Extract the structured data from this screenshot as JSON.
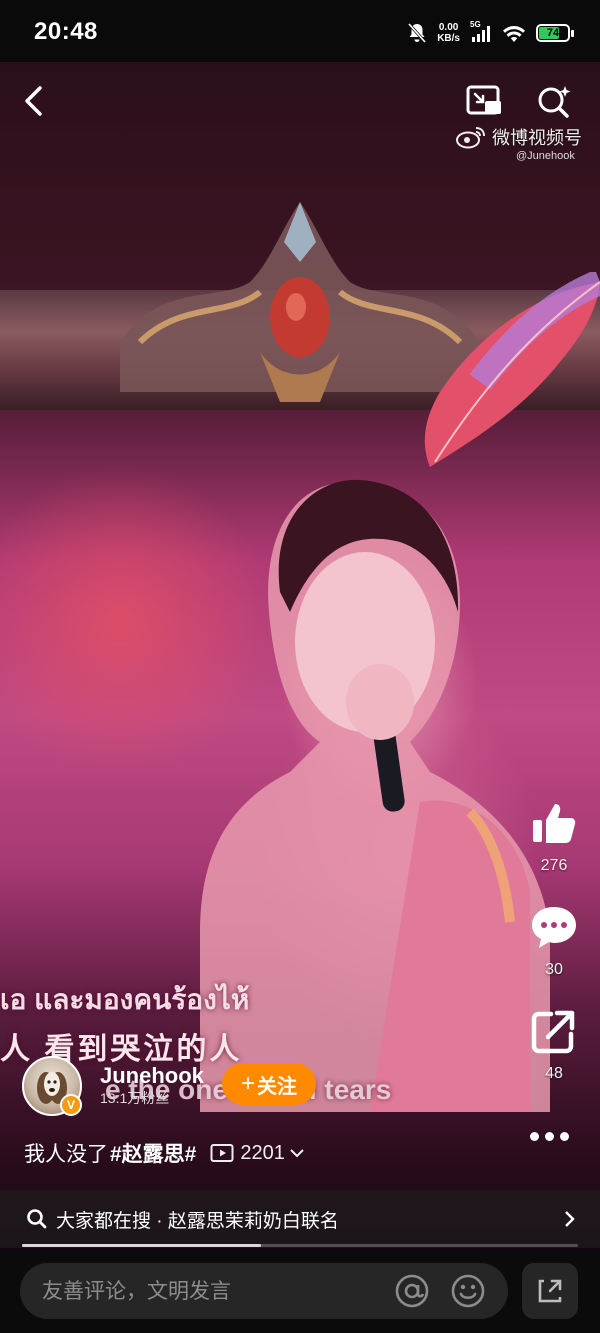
{
  "status_bar": {
    "time": "20:48",
    "net_speed_value": "0.00",
    "net_speed_unit": "KB/s",
    "signal_label": "5G",
    "battery": "74",
    "icons": [
      "mute-bell-icon",
      "signal-icon",
      "wifi-icon",
      "battery-icon"
    ],
    "battery_color": "#34c759"
  },
  "top_bar": {
    "watermark_brand": "微博视频号",
    "watermark_handle": "@Junehook",
    "icons": [
      "back-arrow-icon",
      "picture-in-picture-icon",
      "ai-search-icon",
      "weibo-logo-icon"
    ]
  },
  "video": {
    "lyrics": [
      "เอ และมองคนร้องไห้",
      "人 看到哭泣的人",
      "e the ones    shed tears"
    ]
  },
  "side_actions": {
    "like_count": "276",
    "comment_count": "30",
    "share_count": "48",
    "icons": [
      "thumbs-up-icon",
      "comment-bubble-icon",
      "share-icon",
      "more-dots-icon"
    ]
  },
  "author": {
    "name": "Junehook",
    "fans": "13.1万粉丝",
    "badge": "V",
    "follow_label": "关注",
    "follow_color": "#ff8a00"
  },
  "caption": {
    "text": "我人没了",
    "hashtag": "#赵露思#",
    "plays": "2201"
  },
  "hot_search": {
    "text": "大家都在搜 · 赵露思茉莉奶白联名"
  },
  "progress": {
    "fraction": 0.43
  },
  "comment_bar": {
    "placeholder": "友善评论，文明发言",
    "icons": [
      "at-icon",
      "emoji-icon",
      "expand-icon"
    ]
  }
}
